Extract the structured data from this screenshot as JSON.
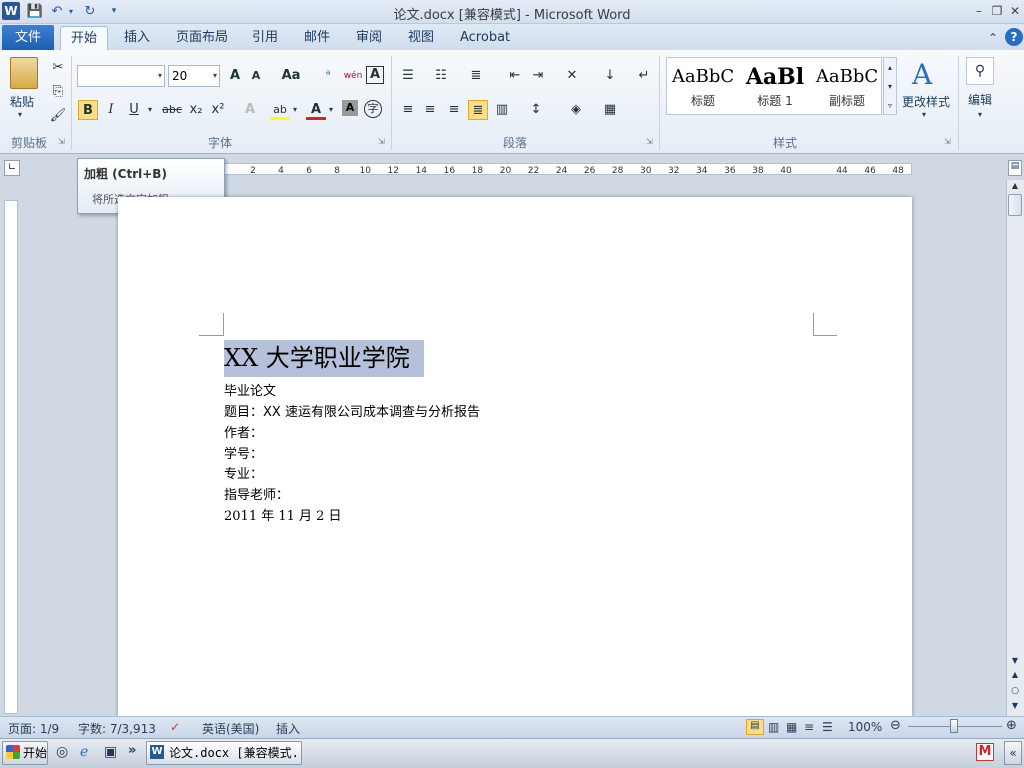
{
  "window": {
    "title": "论文.docx [兼容模式]  -  Microsoft Word"
  },
  "tabs": [
    "文件",
    "开始",
    "插入",
    "页面布局",
    "引用",
    "邮件",
    "审阅",
    "视图",
    "Acrobat"
  ],
  "ribbon": {
    "clipboard": {
      "paste_label": "粘贴",
      "group_label": "剪贴板"
    },
    "font": {
      "font_name": "",
      "font_size": "20",
      "group_label": "字体",
      "bold": "B",
      "italic": "I",
      "underline": "U",
      "strike": "abc",
      "sub": "x₂",
      "sup": "x²",
      "grow": "A",
      "shrink": "A",
      "change_case": "Aa",
      "clear": "A",
      "text_effect": "A",
      "highlight": "ab",
      "font_color": "A",
      "shading": "A",
      "enclose": "字"
    },
    "paragraph": {
      "group_label": "段落"
    },
    "styles": {
      "group_label": "样式",
      "change_styles": "更改样式",
      "items": [
        {
          "sample": "AaBbC",
          "label": "标题"
        },
        {
          "sample": "AaBl",
          "label": "标题 1"
        },
        {
          "sample": "AaBbC",
          "label": "副标题"
        }
      ]
    },
    "editing": {
      "label": "编辑"
    }
  },
  "tooltip": {
    "title": "加粗 (Ctrl+B)",
    "description": "将所选文字加粗。"
  },
  "ruler": {
    "ticks": [
      "2",
      "4",
      "6",
      "8",
      "10",
      "12",
      "14",
      "16",
      "18",
      "20",
      "22",
      "24",
      "26",
      "28",
      "30",
      "32",
      "34",
      "36",
      "38",
      "40",
      "44",
      "46",
      "48"
    ]
  },
  "document": {
    "heading": "XX 大学职业学院",
    "lines": [
      "毕业论文",
      "题目：XX 速运有限公司成本调查与分析报告",
      "作者：",
      "学号：",
      "专业：",
      "指导老师：",
      "2011 年 11 月 2 日"
    ]
  },
  "status": {
    "page": "页面: 1/9",
    "words": "字数: 7/3,913",
    "language": "英语(美国)",
    "insert_mode": "插入",
    "zoom": "100%"
  },
  "taskbar": {
    "start": "开始",
    "task": "论文.docx [兼容模式..."
  },
  "colors": {
    "selection": "#b4c1d8",
    "file_tab": "#2a6cc1",
    "accent_red": "#e02020"
  }
}
